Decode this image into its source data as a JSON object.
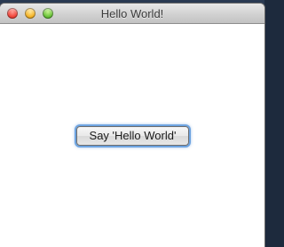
{
  "window": {
    "title": "Hello World!"
  },
  "content": {
    "button_label": "Say 'Hello World'"
  },
  "colors": {
    "close": "#f2473d",
    "minimize": "#f5b52a",
    "zoom": "#6cc43b",
    "focus_ring": "#6da3e0"
  },
  "icons": {
    "close": "close-icon",
    "minimize": "minimize-icon",
    "zoom": "zoom-icon"
  }
}
